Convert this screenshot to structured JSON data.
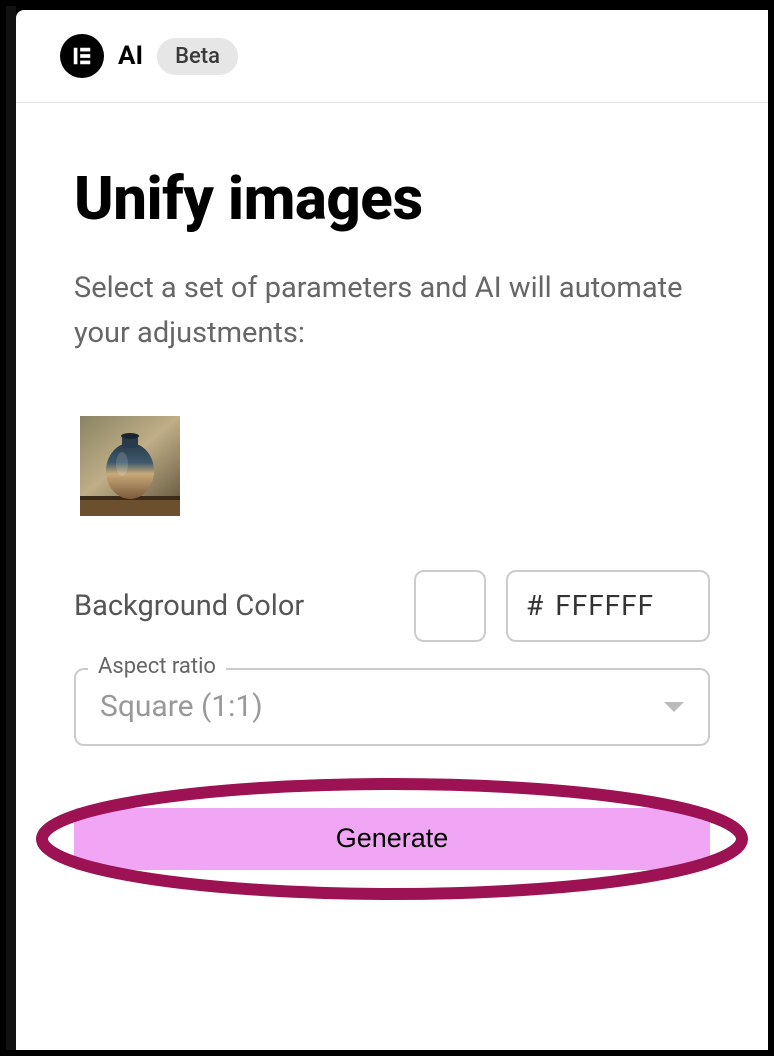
{
  "header": {
    "ai_label": "AI",
    "beta_label": "Beta"
  },
  "title": "Unify images",
  "subtitle": "Select a set of parameters and AI will automate your adjustments:",
  "background_color": {
    "label": "Background Color",
    "hash": "#",
    "hex_value": "FFFFFF",
    "swatch": "#FFFFFF"
  },
  "aspect_ratio": {
    "float_label": "Aspect ratio",
    "value": "Square (1:1)"
  },
  "generate_label": "Generate"
}
